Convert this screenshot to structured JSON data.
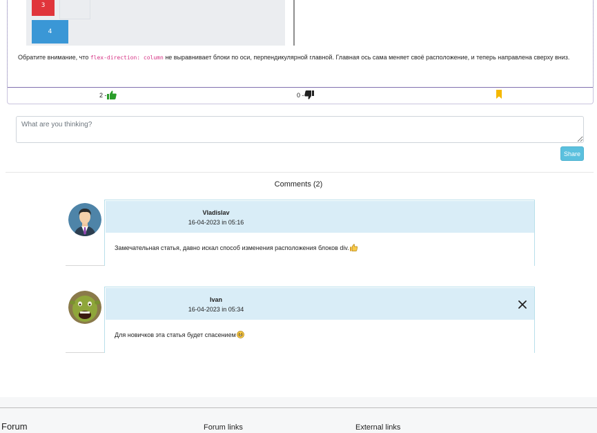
{
  "post": {
    "demo_blocks": [
      "3",
      "4"
    ],
    "text_before": "Обратите внимание, что ",
    "code": "flex-direction: column",
    "text_after": " не выравнивает блоки по оси, перпендикулярной главной. Главная ось сама меняет своё расположение, и теперь направлена сверху вниз.",
    "likes": "2 -",
    "dislikes": "0 -",
    "colors": {
      "like": "#2a9d2a",
      "dislike": "#222222",
      "bookmark": "#f5b800"
    },
    "icons": [
      "thumbs-up-icon",
      "thumbs-down-icon",
      "bookmark-icon"
    ]
  },
  "comment_form": {
    "placeholder": "What are you thinking?",
    "share_label": "Share"
  },
  "comments_title": "Comments (2)",
  "comments": [
    {
      "author": "Vladislav",
      "date": "16-04-2023 in 05:16",
      "text": "Замечательная статья, давно искал способ изменения расположения блоков div.",
      "emoji": "thumbs-up-emoji",
      "deletable": false
    },
    {
      "author": "Ivan",
      "date": "16-04-2023 in 05:34",
      "text": "Для новичков эта статья будет спасением",
      "emoji": "grinning-emoji",
      "deletable": true
    }
  ],
  "footer": {
    "brand": "Forum",
    "forum_links_heading": "Forum links",
    "external_links_heading": "External links"
  }
}
